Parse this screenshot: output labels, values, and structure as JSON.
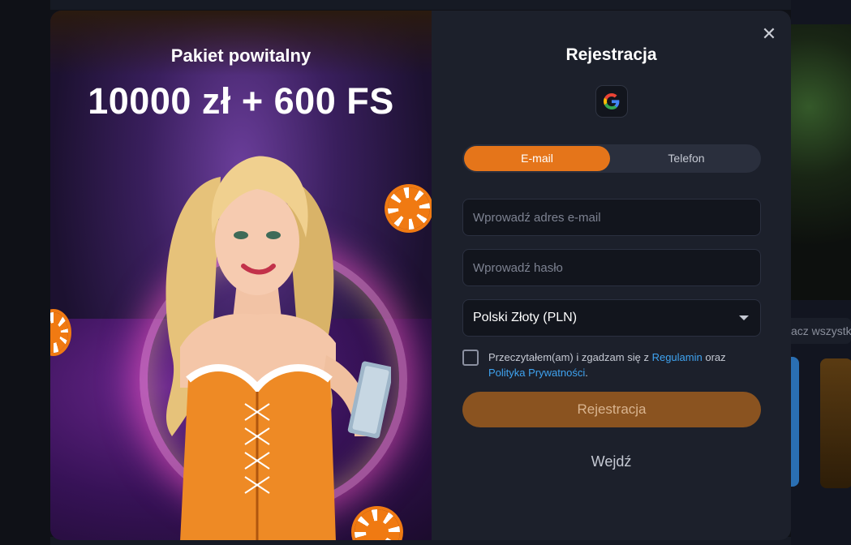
{
  "background": {
    "search_fragment": "acz wszystk"
  },
  "promo": {
    "title": "Pakiet powitalny",
    "amount": "10000 zł + 600 FS"
  },
  "form": {
    "title": "Rejestracja",
    "close_icon": "close-icon",
    "google_icon": "google-icon",
    "tabs": [
      {
        "label": "E-mail",
        "active": true
      },
      {
        "label": "Telefon",
        "active": false
      }
    ],
    "email_placeholder": "Wprowadź adres e-mail",
    "password_placeholder": "Wprowadź hasło",
    "currency": "Polski Złoty (PLN)",
    "terms": {
      "prefix": "Przeczytałem(am) i zgadzam się z",
      "link1": "Regulamin",
      "middle": "oraz",
      "link2": "Polityka Prywatności",
      "suffix": "."
    },
    "submit_label": "Rejestracja",
    "login_label": "Wejdź"
  },
  "colors": {
    "accent": "#e5751a",
    "panel": "#1c202b",
    "link": "#3fa3f0"
  }
}
